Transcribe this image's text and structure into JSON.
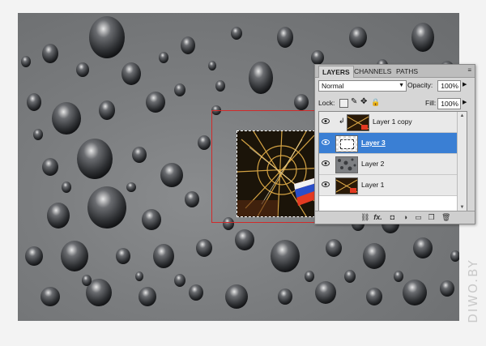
{
  "panel": {
    "tabs": [
      {
        "label": "LAYERS"
      },
      {
        "label": "CHANNELS"
      },
      {
        "label": "PATHS"
      }
    ],
    "menu_icon": "≡",
    "blend_mode": "Normal",
    "opacity_label": "Opacity:",
    "opacity_value": "100%",
    "lock_label": "Lock:",
    "fill_label": "Fill:",
    "fill_value": "100%",
    "layers": [
      {
        "name": "Layer 1 copy",
        "selected": false,
        "clipped": true
      },
      {
        "name": "Layer 3",
        "selected": true,
        "clipped": false
      },
      {
        "name": "Layer 2",
        "selected": false,
        "clipped": false
      },
      {
        "name": "Layer 1",
        "selected": false,
        "clipped": false
      }
    ],
    "footer_icons": [
      "link-icon",
      "fx-icon",
      "mask-icon",
      "adjustment-icon",
      "group-icon",
      "new-layer-icon",
      "trash-icon"
    ],
    "fx_label": "fx."
  },
  "watermark": "DIWO.BY",
  "colors": {
    "selection_blue": "#3a7fd4",
    "highlight_red": "#d12a2a"
  }
}
